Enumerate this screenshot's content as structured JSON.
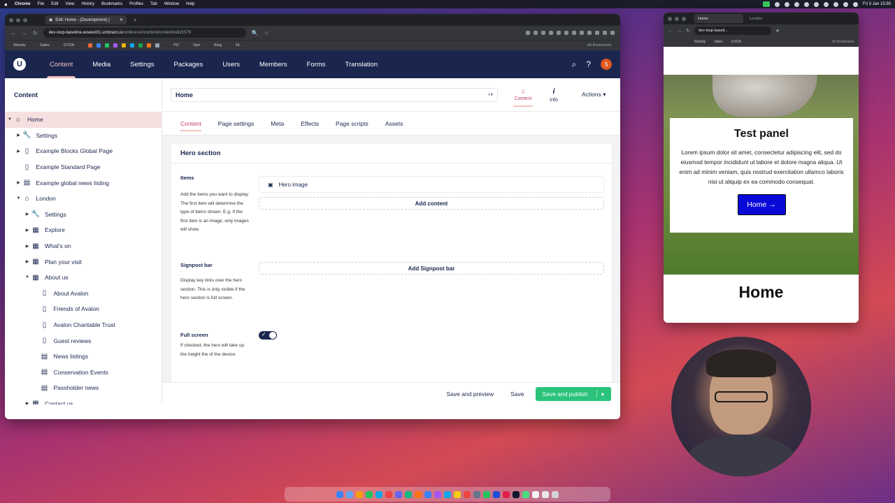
{
  "menubar": {
    "app": "Chrome",
    "items": [
      "File",
      "Edit",
      "View",
      "History",
      "Bookmarks",
      "Profiles",
      "Tab",
      "Window",
      "Help"
    ],
    "clock": "Fri 3 Jan 15:50"
  },
  "browser": {
    "tab_title": "Edit: Home - (Development) |",
    "url_host": "dev-loop-baseline.euwest01.umbraco.io",
    "url_path": "/umbraco#/content/content/edit/1579",
    "bookmarks": [
      "Weekly",
      "Sales",
      "GYDA",
      "PD",
      "Sprt",
      "Blog",
      "NL"
    ],
    "all_bookmarks": "All Bookmarks"
  },
  "umbraco": {
    "nav": [
      "Content",
      "Media",
      "Settings",
      "Packages",
      "Users",
      "Members",
      "Forms",
      "Translation"
    ],
    "active_nav": "Content",
    "avatar_initial": "S"
  },
  "sidebar": {
    "title": "Content",
    "items": [
      {
        "label": "Home",
        "level": 0,
        "icon": "home-icon",
        "caret": "▼",
        "selected": true
      },
      {
        "label": "Settings",
        "level": 1,
        "icon": "wrench-icon",
        "caret": "▶"
      },
      {
        "label": "Example Blocks Global Page",
        "level": 1,
        "icon": "doc-icon",
        "caret": "▶"
      },
      {
        "label": "Example Standard Page",
        "level": 1,
        "icon": "doc-icon",
        "caret": ""
      },
      {
        "label": "Example global news listing",
        "level": 1,
        "icon": "news-icon",
        "caret": "▶"
      },
      {
        "label": "London",
        "level": 1,
        "icon": "home-icon",
        "caret": "▼"
      },
      {
        "label": "Settings",
        "level": 2,
        "icon": "wrench-icon",
        "caret": "▶"
      },
      {
        "label": "Explore",
        "level": 2,
        "icon": "grid-icon",
        "caret": "▶"
      },
      {
        "label": "What's on",
        "level": 2,
        "icon": "grid-icon",
        "caret": "▶"
      },
      {
        "label": "Plan your visit",
        "level": 2,
        "icon": "grid-icon",
        "caret": "▶"
      },
      {
        "label": "About us",
        "level": 2,
        "icon": "grid-icon",
        "caret": "▼"
      },
      {
        "label": "About Avalon",
        "level": 3,
        "icon": "doc-icon",
        "caret": ""
      },
      {
        "label": "Friends of Avalon",
        "level": 3,
        "icon": "doc-icon",
        "caret": ""
      },
      {
        "label": "Avalon Charitable Trust",
        "level": 3,
        "icon": "doc-icon",
        "caret": ""
      },
      {
        "label": "Guest reviews",
        "level": 3,
        "icon": "doc-icon",
        "caret": ""
      },
      {
        "label": "News listings",
        "level": 3,
        "icon": "news-icon",
        "caret": ""
      },
      {
        "label": "Conservation Events",
        "level": 3,
        "icon": "news-icon",
        "caret": ""
      },
      {
        "label": "Passholder news",
        "level": 3,
        "icon": "news-icon",
        "caret": ""
      },
      {
        "label": "Contact us",
        "level": 2,
        "icon": "grid-icon",
        "caret": "▶"
      }
    ]
  },
  "editor": {
    "node_name": "Home",
    "apps": [
      {
        "label": "Content",
        "active": true
      },
      {
        "label": "Info",
        "active": false
      }
    ],
    "actions_label": "Actions",
    "tabs": [
      "Content",
      "Page settings",
      "Meta",
      "Effects",
      "Page scripts",
      "Assets"
    ],
    "active_tab": "Content",
    "group_title": "Hero section",
    "items_label": "Items",
    "items_desc": "Add the items you want to display. The first item will determine the type of items shown. E.g. If the first item is an image, only images will show.",
    "block_label": "Hero image",
    "add_content": "Add content",
    "signpost_label": "Signpost bar",
    "signpost_desc": "Display key links over the hero section. This is only visible if the hero section is full screen.",
    "add_signpost": "Add Signpost bar",
    "fullscreen_label": "Full screen",
    "fullscreen_desc": "If checked, the hero will take up the height the of the device.",
    "fullscreen_on": true
  },
  "footer": {
    "save_preview": "Save and preview",
    "save": "Save",
    "save_publish": "Save and publish"
  },
  "preview": {
    "tab1": "Home",
    "tab2": "London",
    "url": "dev-loop-basell...",
    "bookmarks": [
      "Weekly",
      "Sales",
      "GYDA"
    ],
    "all_bookmarks": "All Bookmarks",
    "card_title": "Test panel",
    "card_text": "Lorem ipsum dolor sit amet, consectetur adipiscing elit, sed do eiusmod tempor incididunt ut labore et dolore magna aliqua. Ut enim ad minim veniam, quis nostrud exercitation ullamco laboris nisi ut aliquip ex ea commodo consequat.",
    "button_label": "Home →",
    "heading": "Home"
  }
}
